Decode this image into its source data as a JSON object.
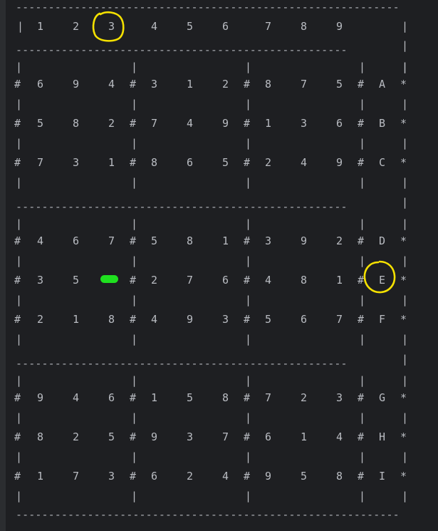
{
  "header": {
    "border_left": "|",
    "border_right": "|",
    "column_labels": [
      "1",
      "2",
      "3",
      "4",
      "5",
      "6",
      "7",
      "8",
      "9"
    ]
  },
  "symbols": {
    "box_edge": "#",
    "separator": "|",
    "row_end": "*",
    "right_bar": "|"
  },
  "rows": [
    {
      "label": "A",
      "cells": [
        "6",
        "9",
        "4",
        "3",
        "1",
        "2",
        "8",
        "7",
        "5"
      ]
    },
    {
      "label": "B",
      "cells": [
        "5",
        "8",
        "2",
        "7",
        "4",
        "9",
        "1",
        "3",
        "6"
      ]
    },
    {
      "label": "C",
      "cells": [
        "7",
        "3",
        "1",
        "8",
        "6",
        "5",
        "2",
        "4",
        "9"
      ]
    },
    {
      "label": "D",
      "cells": [
        "4",
        "6",
        "7",
        "5",
        "8",
        "1",
        "3",
        "9",
        "2"
      ]
    },
    {
      "label": "E",
      "cells": [
        "3",
        "5",
        "",
        "2",
        "7",
        "6",
        "4",
        "8",
        "1"
      ]
    },
    {
      "label": "F",
      "cells": [
        "2",
        "1",
        "8",
        "4",
        "9",
        "3",
        "5",
        "6",
        "7"
      ]
    },
    {
      "label": "G",
      "cells": [
        "9",
        "4",
        "6",
        "1",
        "5",
        "8",
        "7",
        "2",
        "3"
      ]
    },
    {
      "label": "H",
      "cells": [
        "8",
        "2",
        "5",
        "9",
        "3",
        "7",
        "6",
        "1",
        "4"
      ]
    },
    {
      "label": "I",
      "cells": [
        "1",
        "7",
        "3",
        "6",
        "2",
        "4",
        "9",
        "5",
        "8"
      ]
    }
  ],
  "colors": {
    "background": "#1e1f22",
    "text": "#b9bcc2",
    "annotation": "#f5e100",
    "cursor": "#1fe01f"
  },
  "annotations": {
    "circled_column": "3",
    "circled_row": "E",
    "cursor_cell": {
      "row": "E",
      "column": "3"
    }
  }
}
